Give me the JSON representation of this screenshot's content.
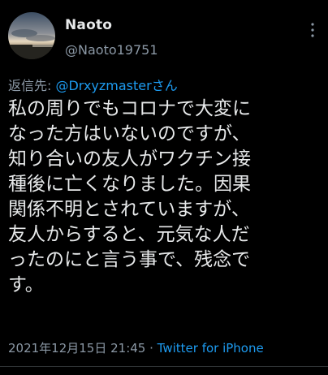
{
  "tweet": {
    "author": {
      "display_name": "Naoto",
      "handle": "@Naoto19751"
    },
    "reply": {
      "prefix": "返信先: ",
      "to_handle": "@Drxyzmasterさん"
    },
    "body_lines": [
      "私の周りでもコロナで大変に",
      "なった方はいないのですが、",
      "知り合いの友人がワクチン接",
      "種後に亡くなりました。因果",
      "関係不明とされていますが、",
      "友人からすると、元気な人だ",
      "ったのにと言う事で、残念で",
      "す。"
    ],
    "timestamp": "2021年12月15日 21:45",
    "separator": " · ",
    "source": "Twitter for iPhone"
  },
  "colors": {
    "background": "#000000",
    "text": "#e7e9ea",
    "secondary": "#8b98a5",
    "link": "#1d9bf0"
  },
  "icons": {
    "more": "more-vertical-icon",
    "avatar": "avatar-sunset-photo"
  }
}
